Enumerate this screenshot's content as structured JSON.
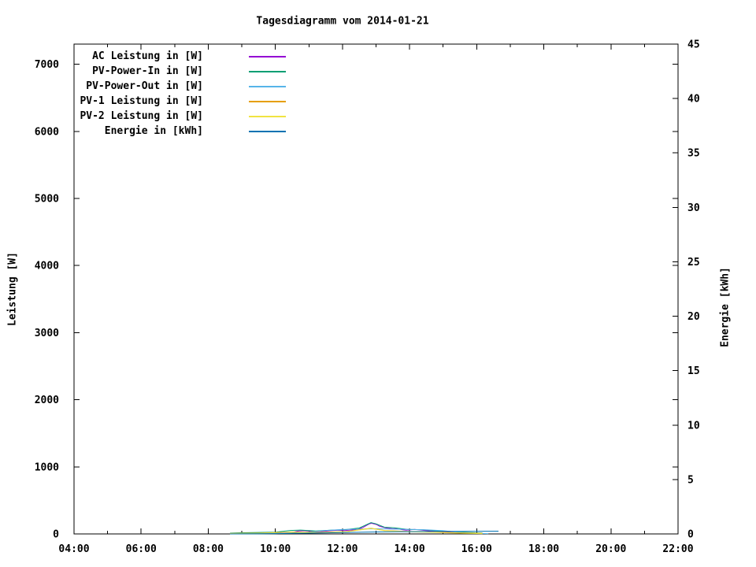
{
  "background_color": "#ffffff",
  "chart_data": {
    "type": "line",
    "title": "Tagesdiagramm vom 2014-01-21",
    "grid": false,
    "legend_position": "top-left-inside",
    "x_axis": {
      "unit": "time",
      "min": 4,
      "max": 22,
      "major_step": 2,
      "minor_step": 1,
      "tick_labels": [
        "04:00",
        "06:00",
        "08:00",
        "10:00",
        "12:00",
        "14:00",
        "16:00",
        "18:00",
        "20:00",
        "22:00"
      ]
    },
    "y_axis": {
      "label": "Leistung [W]",
      "min": 0,
      "max": 7300,
      "ticks": [
        0,
        1000,
        2000,
        3000,
        4000,
        5000,
        6000,
        7000
      ]
    },
    "y2_axis": {
      "label": "Energie [kWh]",
      "min": 0,
      "max": 45,
      "ticks": [
        0,
        5,
        10,
        15,
        20,
        25,
        30,
        35,
        40,
        45
      ]
    },
    "series": [
      {
        "label": "AC Leistung in [W]",
        "color": "#9400d3",
        "axis": "y",
        "points": [
          [
            8.65,
            6
          ],
          [
            8.9,
            9
          ],
          [
            9.2,
            11
          ],
          [
            9.5,
            13
          ],
          [
            9.8,
            14
          ],
          [
            10.1,
            15
          ],
          [
            10.35,
            18
          ],
          [
            10.55,
            28
          ],
          [
            10.7,
            44
          ],
          [
            10.85,
            48
          ],
          [
            11.0,
            42
          ],
          [
            11.15,
            36
          ],
          [
            11.3,
            32
          ],
          [
            11.45,
            38
          ],
          [
            11.6,
            46
          ],
          [
            11.75,
            52
          ],
          [
            11.9,
            56
          ],
          [
            12.05,
            50
          ],
          [
            12.2,
            56
          ],
          [
            12.35,
            60
          ],
          [
            12.5,
            76
          ],
          [
            12.62,
            98
          ],
          [
            12.72,
            128
          ],
          [
            12.8,
            150
          ],
          [
            12.87,
            158
          ],
          [
            12.95,
            148
          ],
          [
            13.02,
            138
          ],
          [
            13.1,
            115
          ],
          [
            13.18,
            105
          ],
          [
            13.28,
            90
          ],
          [
            13.4,
            82
          ],
          [
            13.5,
            76
          ],
          [
            13.6,
            80
          ],
          [
            13.7,
            70
          ],
          [
            13.8,
            62
          ],
          [
            13.9,
            56
          ],
          [
            14.0,
            60
          ],
          [
            14.15,
            68
          ],
          [
            14.3,
            60
          ],
          [
            14.45,
            52
          ],
          [
            14.65,
            45
          ],
          [
            14.85,
            38
          ],
          [
            15.05,
            32
          ],
          [
            15.25,
            26
          ],
          [
            15.45,
            20
          ],
          [
            15.65,
            16
          ],
          [
            15.85,
            12
          ],
          [
            16.05,
            9
          ],
          [
            16.17,
            7
          ]
        ]
      },
      {
        "label": "PV-Power-In in [W]",
        "color": "#009e73",
        "axis": "y",
        "points": [
          [
            8.65,
            12
          ],
          [
            9.0,
            18
          ],
          [
            9.5,
            22
          ],
          [
            10.0,
            26
          ],
          [
            10.45,
            52
          ],
          [
            10.75,
            58
          ],
          [
            11.2,
            44
          ],
          [
            11.65,
            56
          ],
          [
            12.1,
            64
          ],
          [
            12.5,
            88
          ],
          [
            12.85,
            168
          ],
          [
            13.0,
            150
          ],
          [
            13.25,
            100
          ],
          [
            13.55,
            90
          ],
          [
            13.95,
            68
          ],
          [
            14.4,
            62
          ],
          [
            14.8,
            48
          ],
          [
            15.2,
            36
          ],
          [
            15.6,
            25
          ],
          [
            16.0,
            16
          ],
          [
            16.17,
            13
          ]
        ]
      },
      {
        "label": "PV-Power-Out in [W]",
        "color": "#56b4e9",
        "axis": "y",
        "points": [
          [
            8.65,
            1
          ],
          [
            9.5,
            3
          ],
          [
            10.0,
            5
          ],
          [
            10.5,
            12
          ],
          [
            11.0,
            28
          ],
          [
            11.5,
            52
          ],
          [
            12.0,
            66
          ],
          [
            12.5,
            72
          ],
          [
            13.0,
            76
          ],
          [
            13.5,
            72
          ],
          [
            14.0,
            68
          ],
          [
            14.5,
            62
          ],
          [
            15.0,
            48
          ],
          [
            15.3,
            32
          ],
          [
            15.6,
            18
          ],
          [
            16.0,
            9
          ],
          [
            16.35,
            5
          ]
        ]
      },
      {
        "label": "PV-1 Leistung in [W]",
        "color": "#e69f00",
        "axis": "y",
        "points": [
          [
            8.65,
            7
          ],
          [
            9.5,
            13
          ],
          [
            10.45,
            28
          ],
          [
            11.2,
            24
          ],
          [
            12.1,
            34
          ],
          [
            12.85,
            86
          ],
          [
            13.25,
            52
          ],
          [
            13.95,
            36
          ],
          [
            14.8,
            26
          ],
          [
            15.6,
            14
          ],
          [
            16.17,
            8
          ]
        ]
      },
      {
        "label": "PV-2 Leistung in [W]",
        "color": "#f0e442",
        "axis": "y",
        "points": [
          [
            8.65,
            5
          ],
          [
            9.5,
            10
          ],
          [
            10.45,
            25
          ],
          [
            11.2,
            20
          ],
          [
            12.1,
            30
          ],
          [
            12.85,
            82
          ],
          [
            13.25,
            48
          ],
          [
            13.95,
            32
          ],
          [
            14.8,
            22
          ],
          [
            15.6,
            11
          ],
          [
            16.17,
            5
          ]
        ]
      },
      {
        "label": "Energie in [kWh]",
        "color": "#0072b2",
        "axis": "y2",
        "points": [
          [
            8.65,
            0
          ],
          [
            9.5,
            0.02
          ],
          [
            10.5,
            0.05
          ],
          [
            11.0,
            0.07
          ],
          [
            11.5,
            0.1
          ],
          [
            12.0,
            0.12
          ],
          [
            12.5,
            0.15
          ],
          [
            13.0,
            0.18
          ],
          [
            13.5,
            0.2
          ],
          [
            14.0,
            0.21
          ],
          [
            14.5,
            0.22
          ],
          [
            15.0,
            0.23
          ],
          [
            15.5,
            0.24
          ],
          [
            16.0,
            0.245
          ],
          [
            16.65,
            0.25
          ]
        ]
      }
    ]
  }
}
